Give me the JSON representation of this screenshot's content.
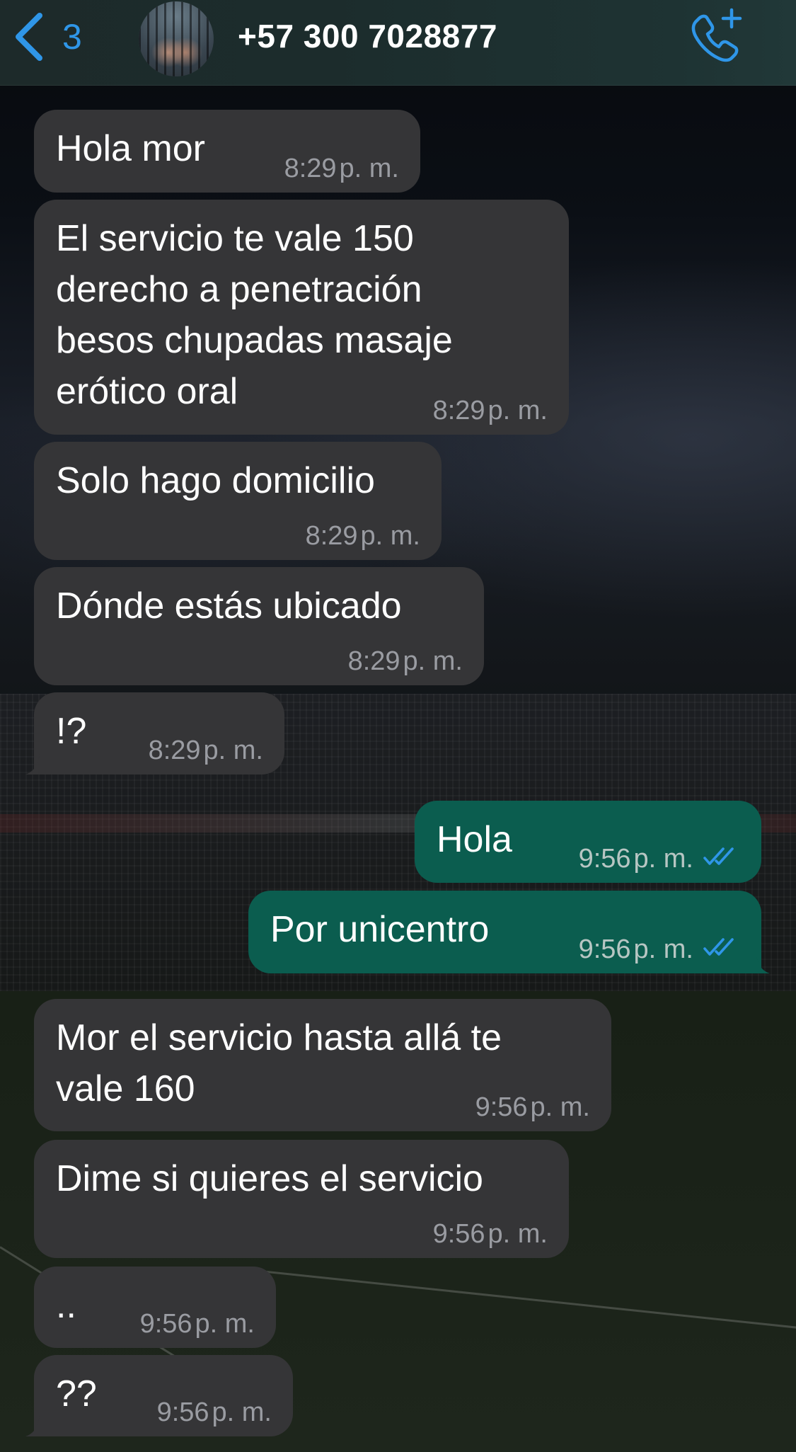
{
  "header": {
    "back_count": "3",
    "contact_name": "+57 300 7028877"
  },
  "colors": {
    "accent_blue": "#2f96e8",
    "incoming_bubble": "#353537",
    "outgoing_bubble": "#0b5d4f",
    "read_ticks": "#2f96e8"
  },
  "icons": {
    "back": "chevron-left-icon",
    "call": "phone-plus-icon",
    "read": "double-check-icon"
  },
  "messages": [
    {
      "text": "Hola mor",
      "time": "8:29",
      "ampm": "p. m."
    },
    {
      "text": "El servicio te vale 150\nderecho a penetración\nbesos chupadas masaje\nerótico oral",
      "time": "8:29",
      "ampm": "p. m."
    },
    {
      "text": "Solo hago domicilio",
      "time": "8:29",
      "ampm": "p. m."
    },
    {
      "text": "Dónde estás ubicado",
      "time": "8:29",
      "ampm": "p. m."
    },
    {
      "text": "!?",
      "time": "8:29",
      "ampm": "p. m."
    },
    {
      "text": "Hola",
      "time": "9:56",
      "ampm": "p. m."
    },
    {
      "text": "Por unicentro",
      "time": "9:56",
      "ampm": "p. m."
    },
    {
      "text": "Mor el servicio hasta allá te\nvale 160",
      "time": "9:56",
      "ampm": "p. m."
    },
    {
      "text": "Dime si quieres el servicio",
      "time": "9:56",
      "ampm": "p. m."
    },
    {
      "text": "..",
      "time": "9:56",
      "ampm": "p. m."
    },
    {
      "text": "??",
      "time": "9:56",
      "ampm": "p. m."
    }
  ]
}
